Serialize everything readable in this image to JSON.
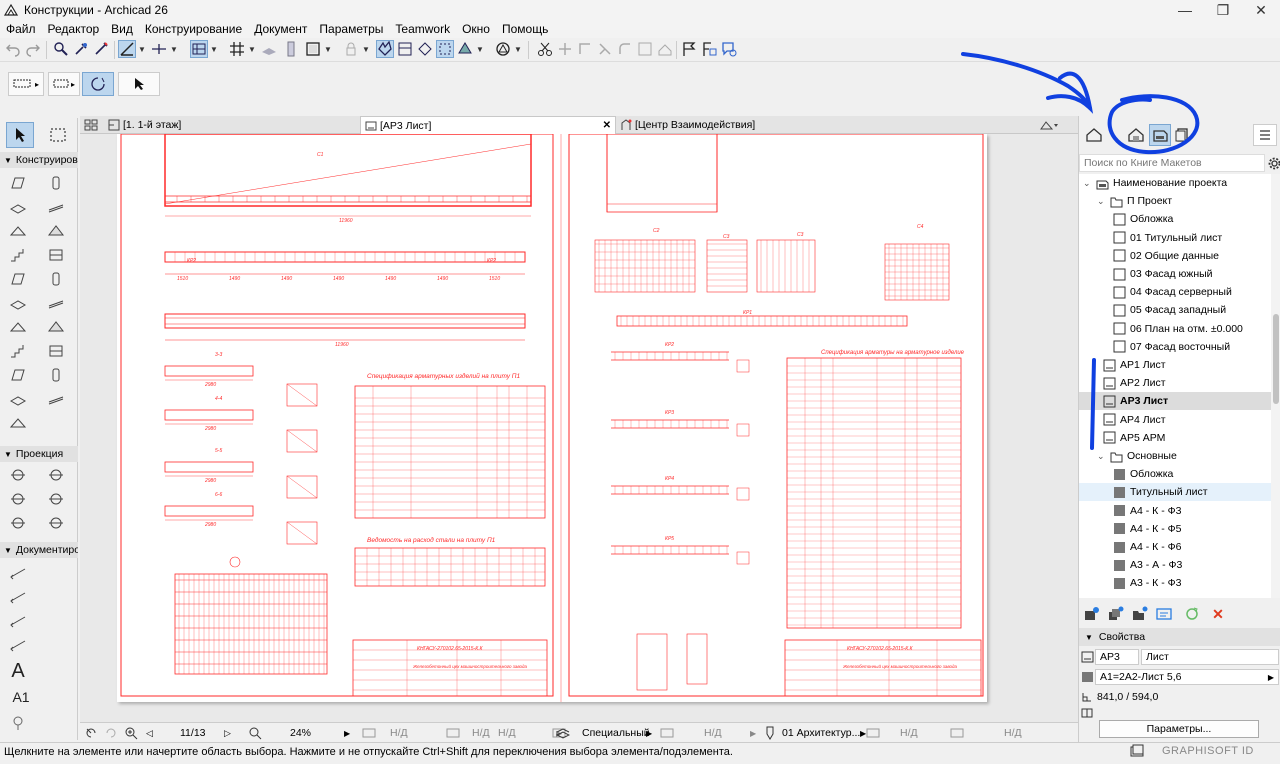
{
  "window": {
    "title": "Конструкции - Archicad 26",
    "min_label": "—",
    "restore_label": "❐",
    "close_label": "✕"
  },
  "menu": [
    "Файл",
    "Редактор",
    "Вид",
    "Конструирование",
    "Документ",
    "Параметры",
    "Teamwork",
    "Окно",
    "Помощь"
  ],
  "toolbox": {
    "groups": [
      "Конструирова",
      "Проекция",
      "Документиров"
    ],
    "text_tool_glyph": "A",
    "label_tool_glyph": "A1"
  },
  "tabs": {
    "plan": "[1. 1-й этаж]",
    "sheet": "[АР3 Лист]",
    "center": "[Центр Взаимодействия]",
    "close": "✕"
  },
  "nav": {
    "search_placeholder": "Поиск по Книге Макетов",
    "tree": [
      {
        "label": "Наименование проекта",
        "type": "root",
        "expanded": true
      },
      {
        "label": "П Проект",
        "type": "folder",
        "expanded": true
      },
      {
        "label": "Обложка",
        "type": "page"
      },
      {
        "label": "01 Титульный лист",
        "type": "page"
      },
      {
        "label": "02 Общие данные",
        "type": "page"
      },
      {
        "label": "03 Фасад южный",
        "type": "page"
      },
      {
        "label": "04 Фасад серверный",
        "type": "page"
      },
      {
        "label": "05 Фасад западный",
        "type": "page"
      },
      {
        "label": "06 План на отм. ±0.000",
        "type": "page"
      },
      {
        "label": "07 Фасад восточный",
        "type": "page"
      },
      {
        "label": "АР1 Лист",
        "type": "sheet"
      },
      {
        "label": "АР2 Лист",
        "type": "sheet"
      },
      {
        "label": "АР3 Лист",
        "type": "sheet",
        "selected": true
      },
      {
        "label": "АР4 Лист",
        "type": "sheet"
      },
      {
        "label": "АР5 АРМ",
        "type": "sheet"
      },
      {
        "label": "Основные",
        "type": "folder",
        "expanded": true
      },
      {
        "label": "Обложка",
        "type": "master"
      },
      {
        "label": "Титульный лист",
        "type": "master",
        "hover": true
      },
      {
        "label": "А4 - К - Ф3",
        "type": "master"
      },
      {
        "label": "А4 - К - Ф5",
        "type": "master"
      },
      {
        "label": "А4 - К - Ф6",
        "type": "master"
      },
      {
        "label": "А3 - А - Ф3",
        "type": "master"
      },
      {
        "label": "А3 - К - Ф3",
        "type": "master"
      }
    ],
    "props": {
      "title": "Свойства",
      "id": "АР3",
      "name": "Лист",
      "master": "А1=2А2-Лист 5,6",
      "size": "841,0 / 594,0",
      "button": "Параметры..."
    }
  },
  "statusnav": {
    "page": "11/13",
    "zoom": "24%",
    "na": "Н/Д",
    "layer": "Специальный",
    "penset": "01 Архитектур..."
  },
  "status": {
    "message": "Щелкните на элементе или начертите область выбора. Нажмите и не отпускайте Ctrl+Shift для переключения выбора элемента/подэлемента.",
    "brand": "GRAPHISOFT ID"
  },
  "drawing": {
    "left_titles": [
      "Спецификация арматурных изделий на плиту П1",
      "Ведомость на расход стали на плиту П1"
    ],
    "right_title": "Спецификация арматуры на арматурное изделие",
    "stamp_code": "КНГАСУ-270102.65-2015-К.К",
    "stamp_text": "Железобетонный цех машиностроительного завода",
    "labels_left": [
      "С1",
      "КР2",
      "3-3",
      "4-4",
      "5-5",
      "6-6",
      "11960",
      "2980",
      "1490"
    ],
    "labels_right": [
      "С2",
      "С3",
      "С4",
      "КР1",
      "КР2",
      "КР3",
      "КР4",
      "КР5"
    ]
  },
  "colors": {
    "drawing": "#ff2a2a",
    "annotation": "#1040e0",
    "selection": "#bcd6ee"
  }
}
